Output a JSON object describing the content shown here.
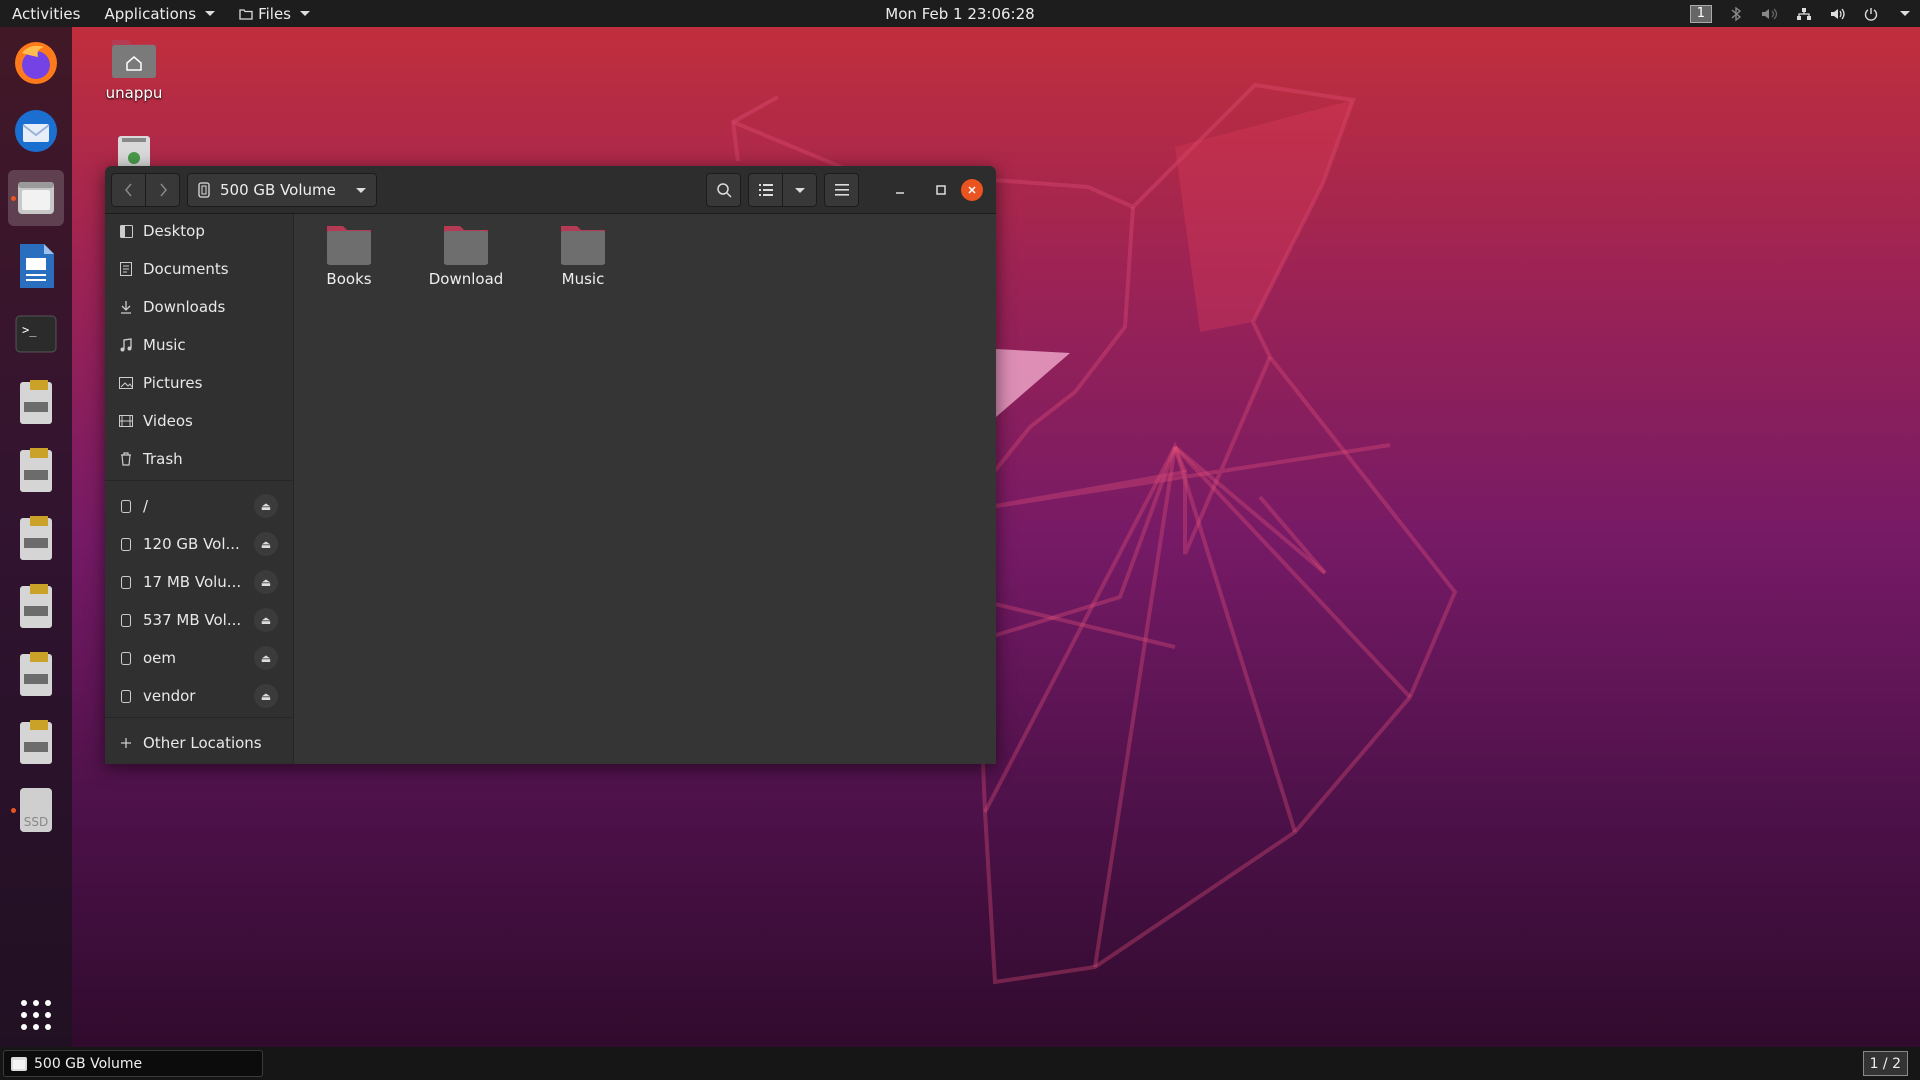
{
  "topbar": {
    "activities": "Activities",
    "applications": "Applications",
    "files_menu": "Files",
    "clock": "Mon Feb 1  23:06:28",
    "workspace": "1"
  },
  "desktop": {
    "home_label": "unappu"
  },
  "dock": {
    "apps": [
      {
        "name": "firefox-icon"
      },
      {
        "name": "thunderbird-icon"
      },
      {
        "name": "files-icon"
      },
      {
        "name": "libreoffice-writer-icon"
      },
      {
        "name": "terminal-icon"
      },
      {
        "name": "drive-icon"
      },
      {
        "name": "drive-icon"
      },
      {
        "name": "drive-icon"
      },
      {
        "name": "drive-icon"
      },
      {
        "name": "drive-icon"
      },
      {
        "name": "drive-icon"
      },
      {
        "name": "ssd-icon",
        "label": "SSD"
      }
    ]
  },
  "window": {
    "location": "500 GB Volume",
    "sidebar": {
      "places": [
        {
          "label": "Desktop",
          "icon": "desktop-icon"
        },
        {
          "label": "Documents",
          "icon": "documents-icon"
        },
        {
          "label": "Downloads",
          "icon": "downloads-icon"
        },
        {
          "label": "Music",
          "icon": "music-icon"
        },
        {
          "label": "Pictures",
          "icon": "pictures-icon"
        },
        {
          "label": "Videos",
          "icon": "videos-icon"
        },
        {
          "label": "Trash",
          "icon": "trash-icon"
        }
      ],
      "devices": [
        {
          "label": "/"
        },
        {
          "label": "120 GB Vol..."
        },
        {
          "label": "17 MB Volu..."
        },
        {
          "label": "537 MB Vol..."
        },
        {
          "label": "oem"
        },
        {
          "label": "vendor"
        }
      ],
      "other_locations": "Other Locations"
    },
    "folders": [
      {
        "label": "Books"
      },
      {
        "label": "Download"
      },
      {
        "label": "Music"
      }
    ]
  },
  "bottombar": {
    "task_label": "500 GB Volume",
    "pager": "1 / 2"
  },
  "colors": {
    "accent": "#e95420",
    "folder": "#6e6e6e",
    "folder_tab": "#b53b55"
  }
}
